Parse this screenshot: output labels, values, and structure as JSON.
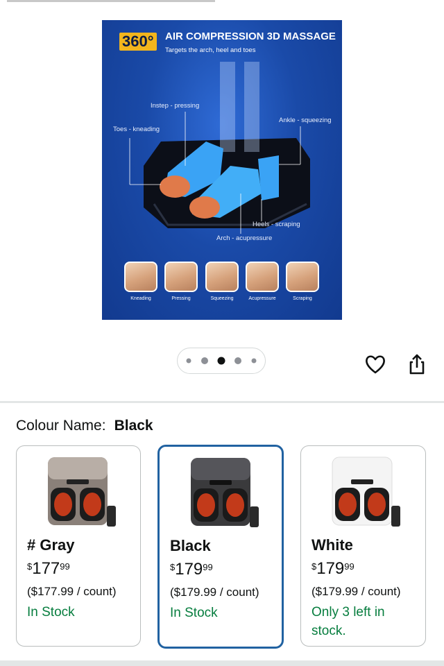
{
  "hero": {
    "badge": "360°",
    "title": "AIR COMPRESSION 3D MASSAGE",
    "subtitle": "Targets the arch, heel and toes",
    "callouts": {
      "instep": "Instep - pressing",
      "toes": "Toes - kneading",
      "ankle": "Ankle - squeezing",
      "heels": "Heels - scraping",
      "arch": "Arch - acupressure"
    },
    "thumbnails": [
      "Kneading",
      "Pressing",
      "Squeezing",
      "Acupressure",
      "Scraping"
    ]
  },
  "pager": {
    "total": 5,
    "active_index": 2
  },
  "actions": {
    "wishlist_icon": "heart-icon",
    "share_icon": "share-icon"
  },
  "colour": {
    "label": "Colour Name:",
    "value": "Black"
  },
  "swatches": [
    {
      "name": "# Gray",
      "currency": "$",
      "price_whole": "177",
      "price_cents": "99",
      "per_count": "($177.99 / count)",
      "stock": "In Stock",
      "selected": false,
      "body_color": "#8a8079"
    },
    {
      "name": "Black",
      "currency": "$",
      "price_whole": "179",
      "price_cents": "99",
      "per_count": "($179.99 / count)",
      "stock": "In Stock",
      "selected": true,
      "body_color": "#3a3a3c"
    },
    {
      "name": "White",
      "currency": "$",
      "price_whole": "179",
      "price_cents": "99",
      "per_count": "($179.99 / count)",
      "stock": "Only 3 left in stock.",
      "selected": false,
      "body_color": "#f4f4f4"
    }
  ],
  "colors": {
    "accent": "#2162a1",
    "in_stock": "#067d3e",
    "badge": "#f2b51d"
  }
}
